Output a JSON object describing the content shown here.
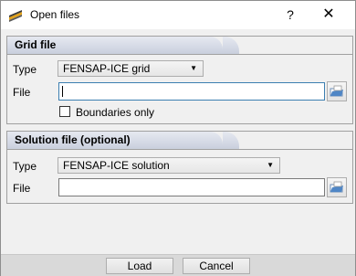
{
  "window": {
    "title": "Open files",
    "help_glyph": "?",
    "close_glyph": "✕"
  },
  "grid": {
    "header": "Grid file",
    "type_label": "Type",
    "type_value": "FENSAP-ICE grid",
    "file_label": "File",
    "file_value": "",
    "boundaries_label": "Boundaries only",
    "boundaries_checked": false
  },
  "solution": {
    "header": "Solution file  (optional)",
    "type_label": "Type",
    "type_value": "FENSAP-ICE solution",
    "file_label": "File",
    "file_value": ""
  },
  "footer": {
    "load_label": "Load",
    "cancel_label": "Cancel"
  },
  "icons": [
    "app-icon",
    "help-icon",
    "close-icon",
    "dropdown-arrow-icon",
    "browse-folder-icon"
  ]
}
